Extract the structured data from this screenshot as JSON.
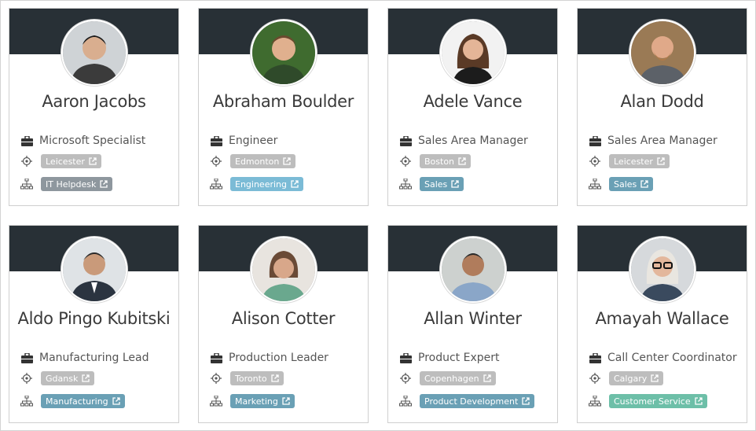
{
  "colors": {
    "banner": "#283036",
    "location_tag": "#bdbdbd",
    "dept_gray": "#8e979e",
    "dept_blue_light": "#7bbbd6",
    "dept_blue": "#6aa0b5",
    "dept_teal": "#6dbfa8"
  },
  "cards": [
    {
      "name": "Aaron Jacobs",
      "title": "Microsoft Specialist",
      "location": "Leicester",
      "department": "IT Helpdesk",
      "dept_color": "#8e979e"
    },
    {
      "name": "Abraham Boulder",
      "title": "Engineer",
      "location": "Edmonton",
      "department": "Engineering",
      "dept_color": "#7bbbd6"
    },
    {
      "name": "Adele Vance",
      "title": "Sales Area Manager",
      "location": "Boston",
      "department": "Sales",
      "dept_color": "#6aa0b5"
    },
    {
      "name": "Alan Dodd",
      "title": "Sales Area Manager",
      "location": "Leicester",
      "department": "Sales",
      "dept_color": "#6aa0b5"
    },
    {
      "name": "Aldo Pingo Kubitski",
      "title": "Manufacturing Lead",
      "location": "Gdansk",
      "department": "Manufacturing",
      "dept_color": "#6aa0b5"
    },
    {
      "name": "Alison Cotter",
      "title": "Production Leader",
      "location": "Toronto",
      "department": "Marketing",
      "dept_color": "#6aa0b5"
    },
    {
      "name": "Allan Winter",
      "title": "Product Expert",
      "location": "Copenhagen",
      "department": "Product Development",
      "dept_color": "#6aa0b5"
    },
    {
      "name": "Amayah Wallace",
      "title": "Call Center Coordinator",
      "location": "Calgary",
      "department": "Customer Service",
      "dept_color": "#6dbfa8"
    }
  ],
  "icons": {
    "job": "briefcase-icon",
    "location": "target-icon",
    "department": "org-chart-icon",
    "link": "external-link-icon"
  }
}
